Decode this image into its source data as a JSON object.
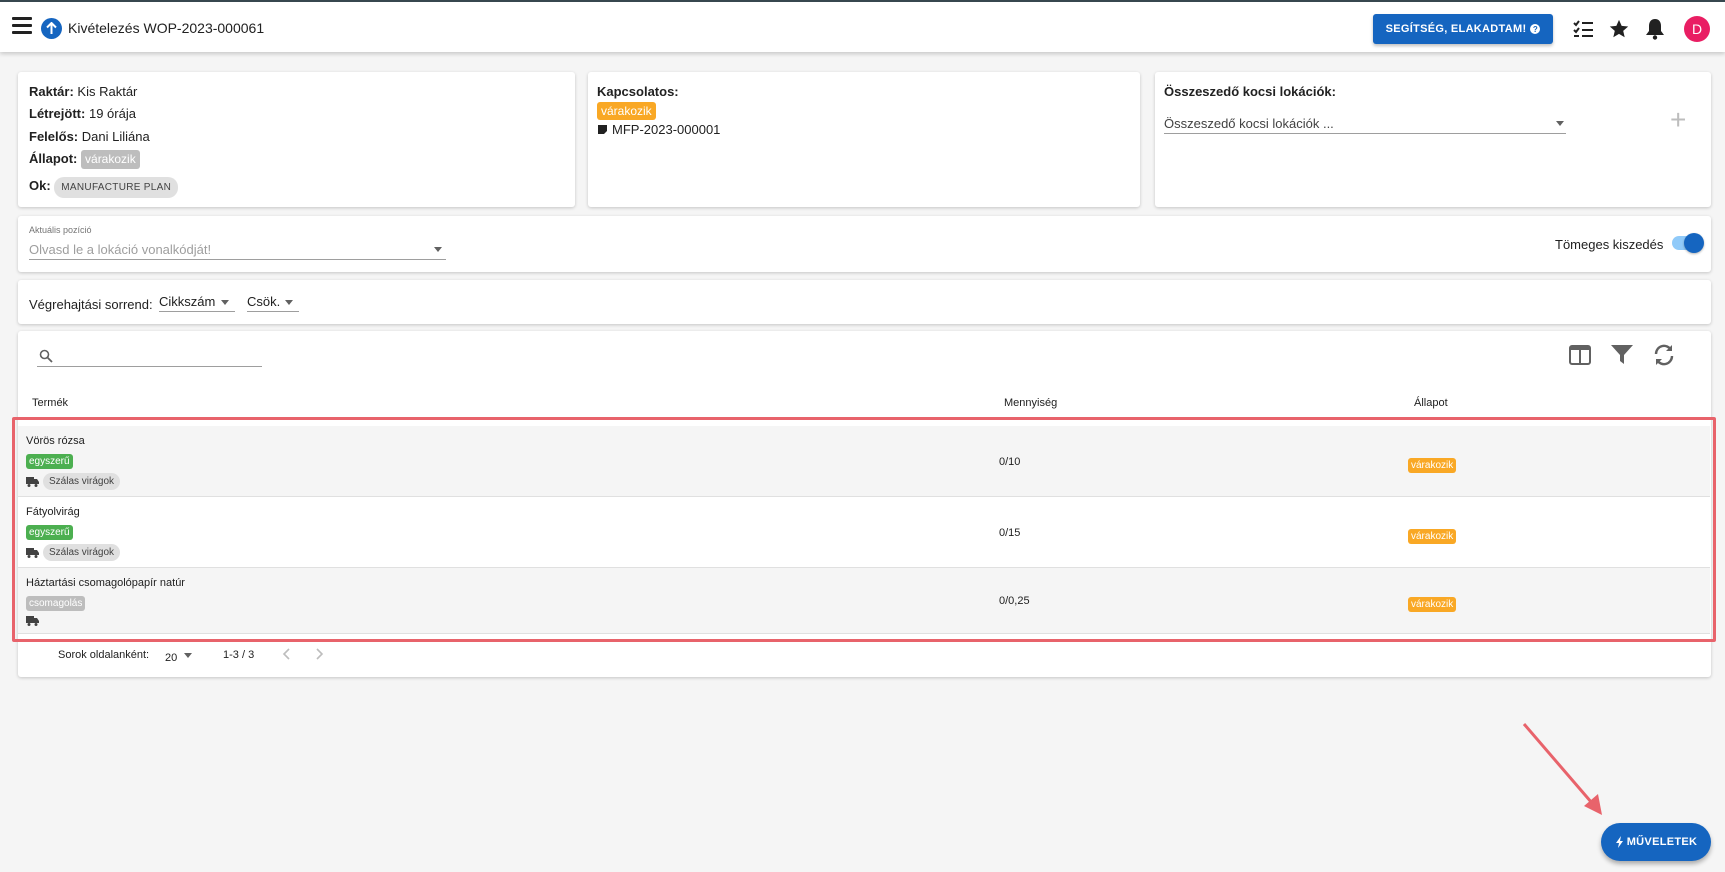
{
  "header": {
    "title": "Kivételezés WOP-2023-000061",
    "help_button": "SEGÍTSÉG, ELAKADTAM!",
    "help_icon_glyph": "?",
    "avatar_letter": "D"
  },
  "info_card": {
    "warehouse_label": "Raktár:",
    "warehouse_value": "Kis Raktár",
    "created_label": "Létrejött:",
    "created_value": "19 órája",
    "responsible_label": "Felelős:",
    "responsible_value": "Dani Liliána",
    "state_label": "Állapot:",
    "state_value": "várakozik",
    "reason_label": "Ok:",
    "reason_value": "MANUFACTURE PLAN"
  },
  "related_card": {
    "title": "Kapcsolatos:",
    "status": "várakozik",
    "link": "MFP-2023-000001"
  },
  "cart_card": {
    "title": "Összeszedő kocsi lokációk:",
    "placeholder": "Összeszedő kocsi lokációk ...",
    "add_glyph": "+"
  },
  "position": {
    "label": "Aktuális pozíció",
    "placeholder": "Olvasd le a lokáció vonalkódját!",
    "bulk_label": "Tömeges kiszedés"
  },
  "order": {
    "label": "Végrehajtási sorrend:",
    "sort_field": "Cikkszám",
    "sort_dir": "Csök."
  },
  "table": {
    "columns": [
      "Termék",
      "Mennyiség",
      "Állapot"
    ],
    "rows": [
      {
        "name": "Vörös rózsa",
        "type": "egyszerű",
        "tag": "Szálas virágok",
        "qty": "0/10",
        "state": "várakozik"
      },
      {
        "name": "Fátyolvirág",
        "type": "egyszerű",
        "tag": "Szálas virágok",
        "qty": "0/15",
        "state": "várakozik"
      },
      {
        "name": "Háztartási csomagolópapír natúr",
        "type": "csomagolás",
        "tag": "",
        "qty": "0/0,25",
        "state": "várakozik"
      }
    ],
    "footer": {
      "rows_per_page_label": "Sorok oldalanként:",
      "rows_per_page": "20",
      "range": "1-3 / 3"
    }
  },
  "fab": {
    "label": "MŰVELETEK"
  },
  "colors": {
    "primary": "#1565c0",
    "waiting": "#f9a825",
    "simple": "#4caf50",
    "highlight": "#e8636b"
  }
}
